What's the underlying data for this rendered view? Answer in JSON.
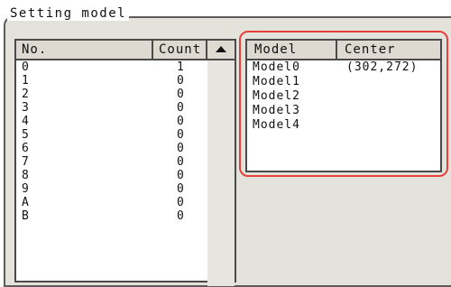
{
  "group_title": "Setting model",
  "count_table": {
    "headers": {
      "no": "No.",
      "count": "Count"
    },
    "rows": [
      {
        "no": "0",
        "count": "1"
      },
      {
        "no": "1",
        "count": "0"
      },
      {
        "no": "2",
        "count": "0"
      },
      {
        "no": "3",
        "count": "0"
      },
      {
        "no": "4",
        "count": "0"
      },
      {
        "no": "5",
        "count": "0"
      },
      {
        "no": "6",
        "count": "0"
      },
      {
        "no": "7",
        "count": "0"
      },
      {
        "no": "8",
        "count": "0"
      },
      {
        "no": "9",
        "count": "0"
      },
      {
        "no": "A",
        "count": "0"
      },
      {
        "no": "B",
        "count": "0"
      }
    ]
  },
  "model_table": {
    "headers": {
      "model": "Model",
      "center": "Center"
    },
    "rows": [
      {
        "model": "Model0",
        "center": "(302,272)"
      },
      {
        "model": "Model1",
        "center": ""
      },
      {
        "model": "Model2",
        "center": ""
      },
      {
        "model": "Model3",
        "center": ""
      },
      {
        "model": "Model4",
        "center": ""
      }
    ]
  },
  "icons": {
    "scroll_up": "triangle-up-icon"
  },
  "colors": {
    "highlight": "#e8403a",
    "panel": "#e3e3dc",
    "header": "#dedad2"
  }
}
